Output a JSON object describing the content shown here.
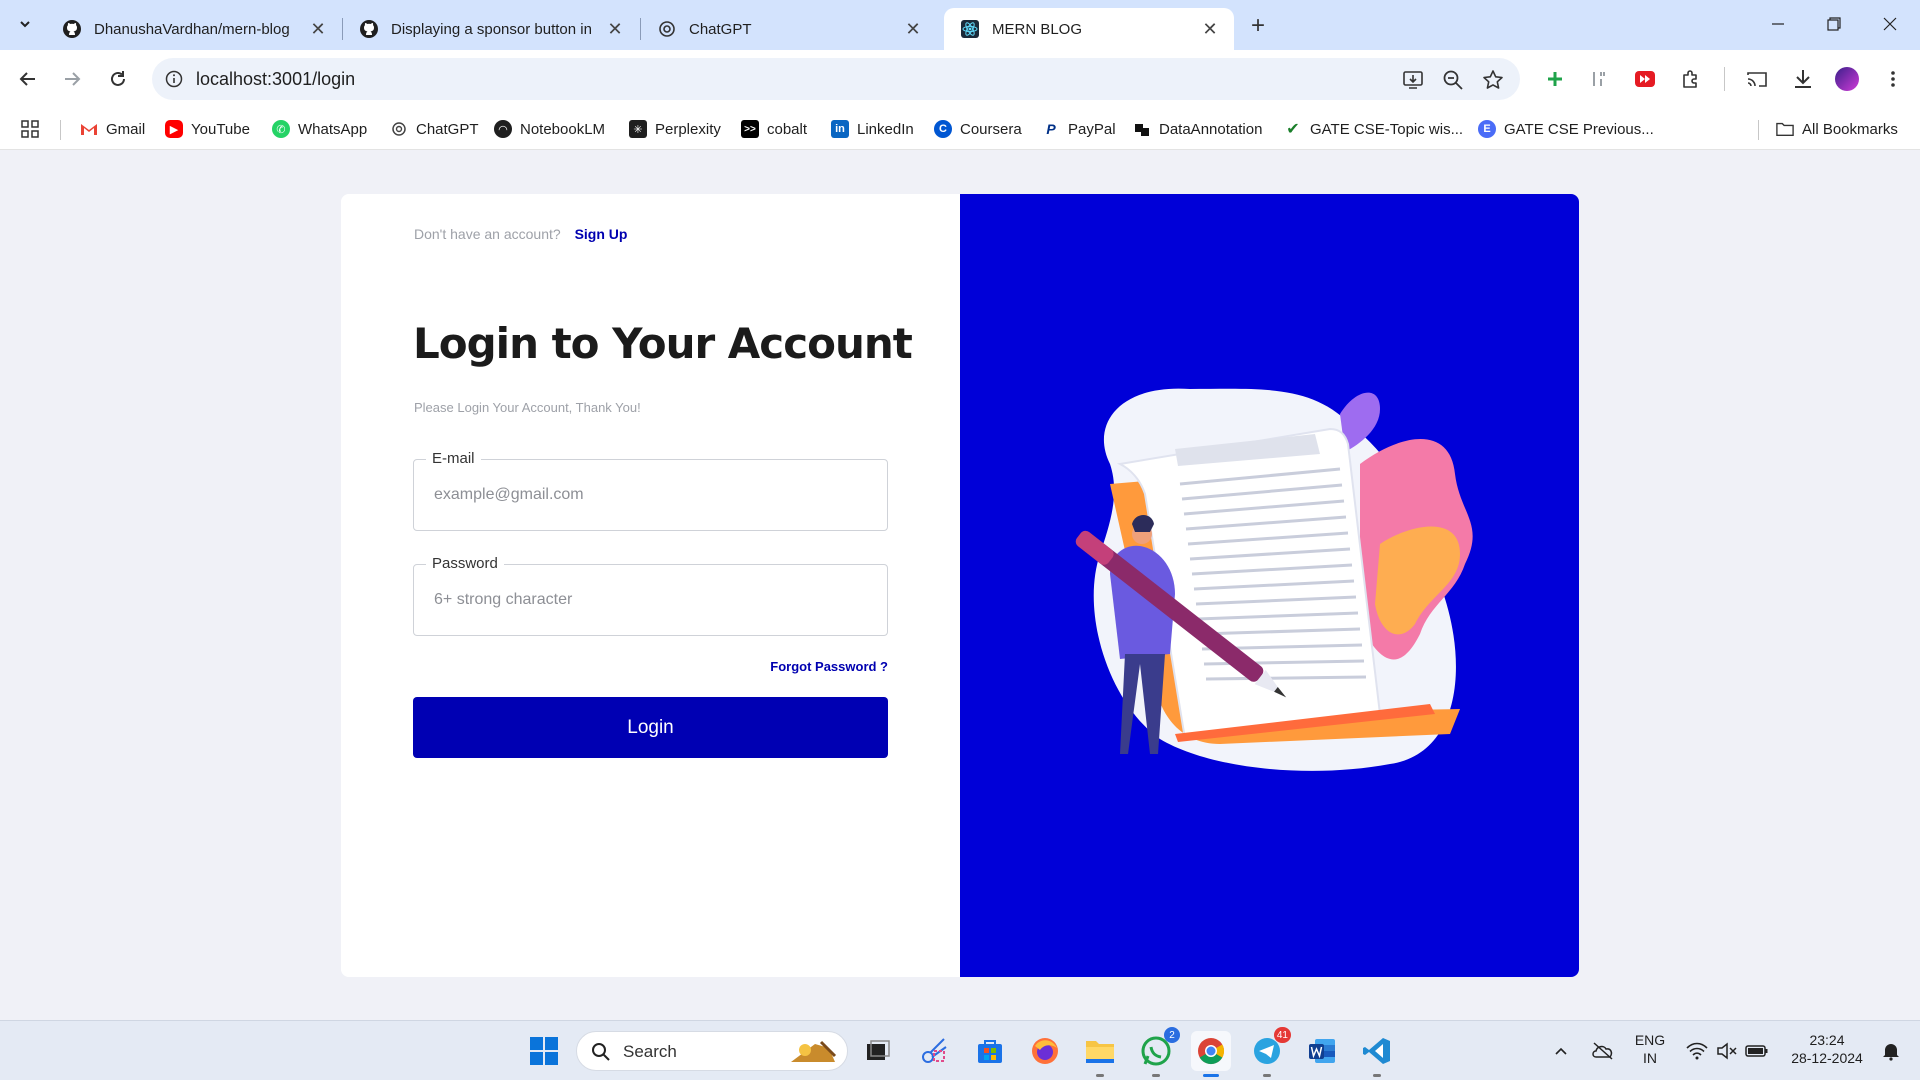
{
  "browser": {
    "tabs": [
      {
        "title": "DhanushaVardhan/mern-blog",
        "icon": "github-icon"
      },
      {
        "title": "Displaying a sponsor button in",
        "icon": "github-icon"
      },
      {
        "title": "ChatGPT",
        "icon": "chatgpt-icon"
      },
      {
        "title": "MERN BLOG",
        "icon": "react-icon",
        "active": true
      }
    ],
    "url": "localhost:3001/login",
    "bookmarks": [
      {
        "label": "Gmail"
      },
      {
        "label": "YouTube"
      },
      {
        "label": "WhatsApp"
      },
      {
        "label": "ChatGPT"
      },
      {
        "label": "NotebookLM"
      },
      {
        "label": "Perplexity"
      },
      {
        "label": "cobalt"
      },
      {
        "label": "LinkedIn"
      },
      {
        "label": "Coursera"
      },
      {
        "label": "PayPal"
      },
      {
        "label": "DataAnnotation"
      },
      {
        "label": "GATE CSE-Topic wis..."
      },
      {
        "label": "GATE CSE Previous..."
      }
    ],
    "all_bookmarks": "All Bookmarks"
  },
  "login": {
    "signup_prompt": "Don't have an account?",
    "signup_link": "Sign Up",
    "title": "Login to Your Account",
    "subtitle": "Please Login Your Account, Thank You!",
    "email_label": "E-mail",
    "email_placeholder": "example@gmail.com",
    "password_label": "Password",
    "password_placeholder": "6+ strong character",
    "forgot": "Forgot Password ?",
    "button": "Login",
    "panel_color": "#0000d8",
    "button_color": "#0000b3"
  },
  "taskbar": {
    "search_label": "Search",
    "whatsapp_badge": "2",
    "telegram_badge": "41",
    "lang_line1": "ENG",
    "lang_line2": "IN",
    "time": "23:24",
    "date": "28-12-2024"
  }
}
